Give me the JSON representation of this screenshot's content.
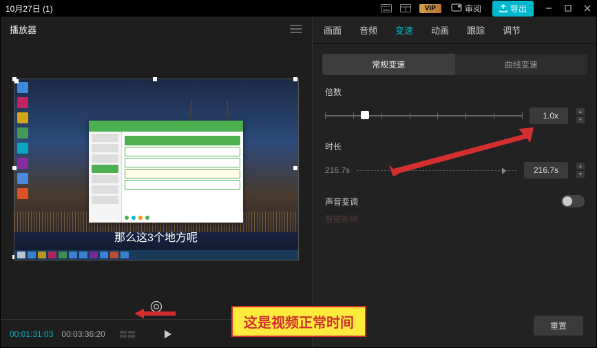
{
  "titlebar": {
    "title": "10月27日 (1)",
    "vip": "VIP",
    "review": "审阅",
    "export": "导出"
  },
  "leftPanel": {
    "title": "播放器",
    "caption": "那么这3个地方呢",
    "timeCurrent": "00:01:31:03",
    "timeTotal": "00:03:36:20"
  },
  "tabs": [
    "画面",
    "音频",
    "变速",
    "动画",
    "跟踪",
    "调节"
  ],
  "activeTab": 2,
  "subtabs": {
    "normal": "常规变速",
    "curve": "曲线变速"
  },
  "speed": {
    "label": "倍数",
    "value": "1.0x"
  },
  "duration": {
    "label": "时长",
    "current": "216.7s",
    "value": "216.7s"
  },
  "pitch": {
    "label": "声音变调"
  },
  "smooth": {
    "label": "智能补帧"
  },
  "reset": "重置",
  "annotation": "这是视频正常时间"
}
